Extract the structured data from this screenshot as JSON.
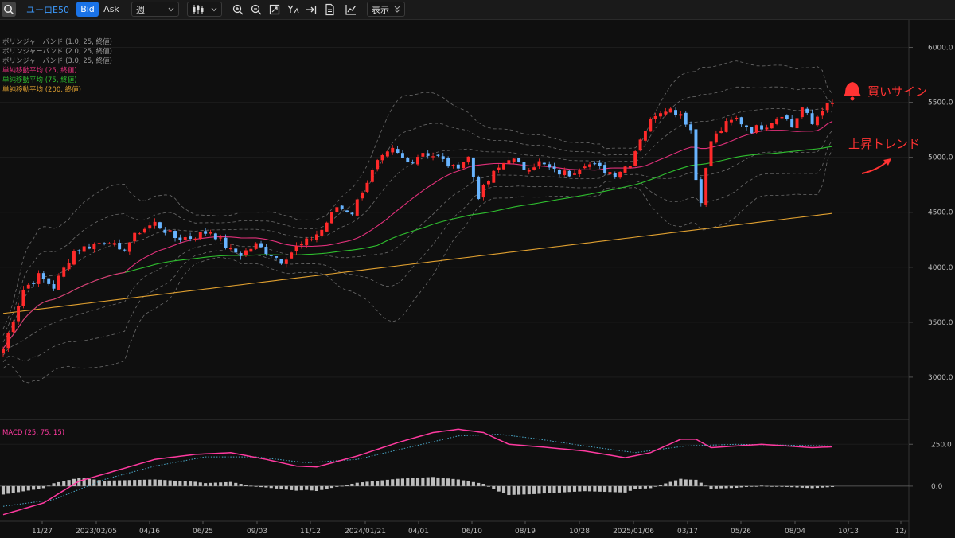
{
  "toolbar": {
    "symbol": "ユーロE50",
    "bid_label": "Bid",
    "ask_label": "Ask",
    "period": "週",
    "display_label": "表示"
  },
  "legend": [
    {
      "label": "ボリンジャーバンド (1.0, 25, 終値)",
      "color": "#9a9a9a"
    },
    {
      "label": "ボリンジャーバンド (2.0, 25, 終値)",
      "color": "#9a9a9a"
    },
    {
      "label": "ボリンジャーバンド (3.0, 25, 終値)",
      "color": "#9a9a9a"
    },
    {
      "label": "単純移動平均 (25, 終値)",
      "color": "#e0307a"
    },
    {
      "label": "単純移動平均 (75, 終値)",
      "color": "#2fc02f"
    },
    {
      "label": "単純移動平均 (200, 終値)",
      "color": "#e0a030"
    }
  ],
  "annotations": {
    "buy_signal": "買いサイン",
    "uptrend": "上昇トレンド"
  },
  "macd_label": "MACD (25, 75, 15)",
  "colors": {
    "up": "#ff2a2a",
    "down": "#68b4ff",
    "sma25": "#e0307a",
    "sma75": "#2fc02f",
    "sma200": "#e0a030",
    "band": "#8a8a8a",
    "macd": "#ff3aa0",
    "signal": "#4aa8c8",
    "hist": "#bdbdbd",
    "annotation": "#ff3333",
    "accent": "#1a73e8"
  },
  "chart_data": [
    {
      "type": "candlestick",
      "title": "ユーロE50",
      "period": "週",
      "x_ticks": [
        "11/27",
        "2023/02/05",
        "04/16",
        "06/25",
        "09/03",
        "11/12",
        "2024/01/21",
        "04/01",
        "06/10",
        "08/19",
        "10/28",
        "2025/01/06",
        "03/17",
        "05/26",
        "08/04",
        "10/13",
        "12/"
      ],
      "y_ticks": [
        3000,
        3500,
        4000,
        4500,
        5000,
        5500,
        6000
      ],
      "ylim": [
        2630,
        6250
      ],
      "close_keypoints": [
        [
          0,
          3260
        ],
        [
          4,
          3800
        ],
        [
          7,
          3920
        ],
        [
          10,
          3820
        ],
        [
          14,
          4150
        ],
        [
          21,
          4250
        ],
        [
          23,
          4130
        ],
        [
          27,
          4330
        ],
        [
          30,
          4400
        ],
        [
          34,
          4270
        ],
        [
          37,
          4270
        ],
        [
          41,
          4330
        ],
        [
          45,
          4150
        ],
        [
          47,
          4120
        ],
        [
          50,
          4200
        ],
        [
          53,
          4120
        ],
        [
          55,
          4060
        ],
        [
          58,
          4180
        ],
        [
          60,
          4230
        ],
        [
          63,
          4340
        ],
        [
          66,
          4550
        ],
        [
          69,
          4500
        ],
        [
          71,
          4700
        ],
        [
          74,
          4950
        ],
        [
          77,
          5060
        ],
        [
          80,
          4950
        ],
        [
          83,
          5050
        ],
        [
          86,
          5000
        ],
        [
          89,
          4900
        ],
        [
          92,
          5000
        ],
        [
          94,
          4650
        ],
        [
          97,
          4850
        ],
        [
          100,
          5000
        ],
        [
          103,
          4900
        ],
        [
          106,
          4950
        ],
        [
          109,
          4870
        ],
        [
          112,
          4850
        ],
        [
          115,
          4950
        ],
        [
          118,
          4900
        ],
        [
          121,
          4850
        ],
        [
          124,
          4950
        ],
        [
          126,
          5180
        ],
        [
          129,
          5400
        ],
        [
          131,
          5450
        ],
        [
          134,
          5400
        ],
        [
          136,
          5250
        ],
        [
          137,
          4800
        ],
        [
          138,
          4620
        ],
        [
          140,
          5150
        ],
        [
          143,
          5300
        ],
        [
          145,
          5350
        ],
        [
          148,
          5250
        ],
        [
          151,
          5300
        ],
        [
          154,
          5400
        ],
        [
          156,
          5280
        ],
        [
          158,
          5450
        ],
        [
          160,
          5300
        ],
        [
          162,
          5450
        ],
        [
          164,
          5480
        ]
      ],
      "sma200_endpoints": [
        [
          0,
          3580
        ],
        [
          164,
          4490
        ]
      ],
      "price_series": [
        "ローソク足",
        "ボリンジャーバンド ±1σ/±2σ/±3σ",
        "SMA25",
        "SMA75",
        "SMA200"
      ]
    },
    {
      "type": "line",
      "title": "MACD (25, 75, 15)",
      "y_ticks": [
        0.0,
        250.0
      ],
      "ylim": [
        -200,
        370
      ],
      "macd_keypoints": [
        [
          0,
          -170
        ],
        [
          8,
          -100
        ],
        [
          15,
          30
        ],
        [
          22,
          90
        ],
        [
          30,
          160
        ],
        [
          38,
          190
        ],
        [
          45,
          200
        ],
        [
          52,
          160
        ],
        [
          58,
          120
        ],
        [
          62,
          115
        ],
        [
          70,
          180
        ],
        [
          78,
          260
        ],
        [
          85,
          320
        ],
        [
          90,
          340
        ],
        [
          95,
          320
        ],
        [
          100,
          250
        ],
        [
          108,
          230
        ],
        [
          115,
          210
        ],
        [
          123,
          170
        ],
        [
          128,
          200
        ],
        [
          134,
          280
        ],
        [
          137,
          280
        ],
        [
          140,
          230
        ],
        [
          150,
          250
        ],
        [
          160,
          230
        ],
        [
          164,
          235
        ]
      ],
      "signal_keypoints": [
        [
          0,
          -120
        ],
        [
          10,
          -80
        ],
        [
          20,
          40
        ],
        [
          30,
          120
        ],
        [
          40,
          175
        ],
        [
          50,
          175
        ],
        [
          60,
          140
        ],
        [
          70,
          160
        ],
        [
          80,
          230
        ],
        [
          90,
          300
        ],
        [
          98,
          310
        ],
        [
          105,
          285
        ],
        [
          115,
          240
        ],
        [
          125,
          200
        ],
        [
          135,
          240
        ],
        [
          145,
          250
        ],
        [
          164,
          240
        ]
      ],
      "series": [
        {
          "name": "MACD"
        },
        {
          "name": "Signal"
        },
        {
          "name": "Histogram"
        }
      ]
    }
  ]
}
